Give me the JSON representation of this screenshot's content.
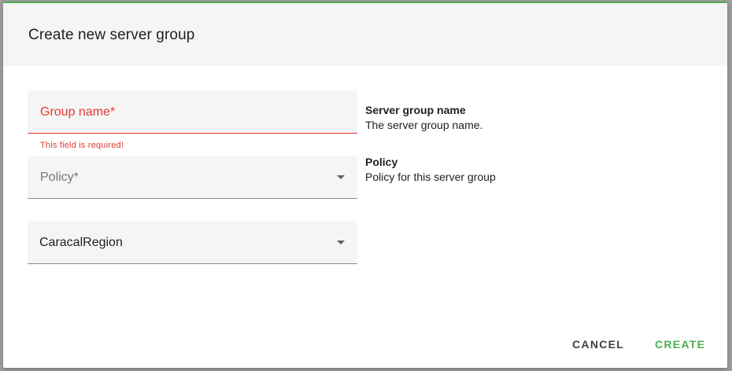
{
  "dialog": {
    "title": "Create new server group",
    "accent_color": "#4caf50",
    "error_color": "#e53935"
  },
  "form": {
    "group_name": {
      "label": "Group name*",
      "value": "",
      "error": "This field is required!"
    },
    "policy": {
      "label": "Policy*",
      "value": ""
    },
    "region": {
      "value": "CaracalRegion"
    }
  },
  "info": {
    "group_name": {
      "title": "Server group name",
      "description": "The server group name."
    },
    "policy": {
      "title": "Policy",
      "description": "Policy for this server group"
    }
  },
  "actions": {
    "cancel_label": "CANCEL",
    "create_label": "CREATE"
  },
  "icons": {
    "dropdown": "chevron-down-icon"
  }
}
